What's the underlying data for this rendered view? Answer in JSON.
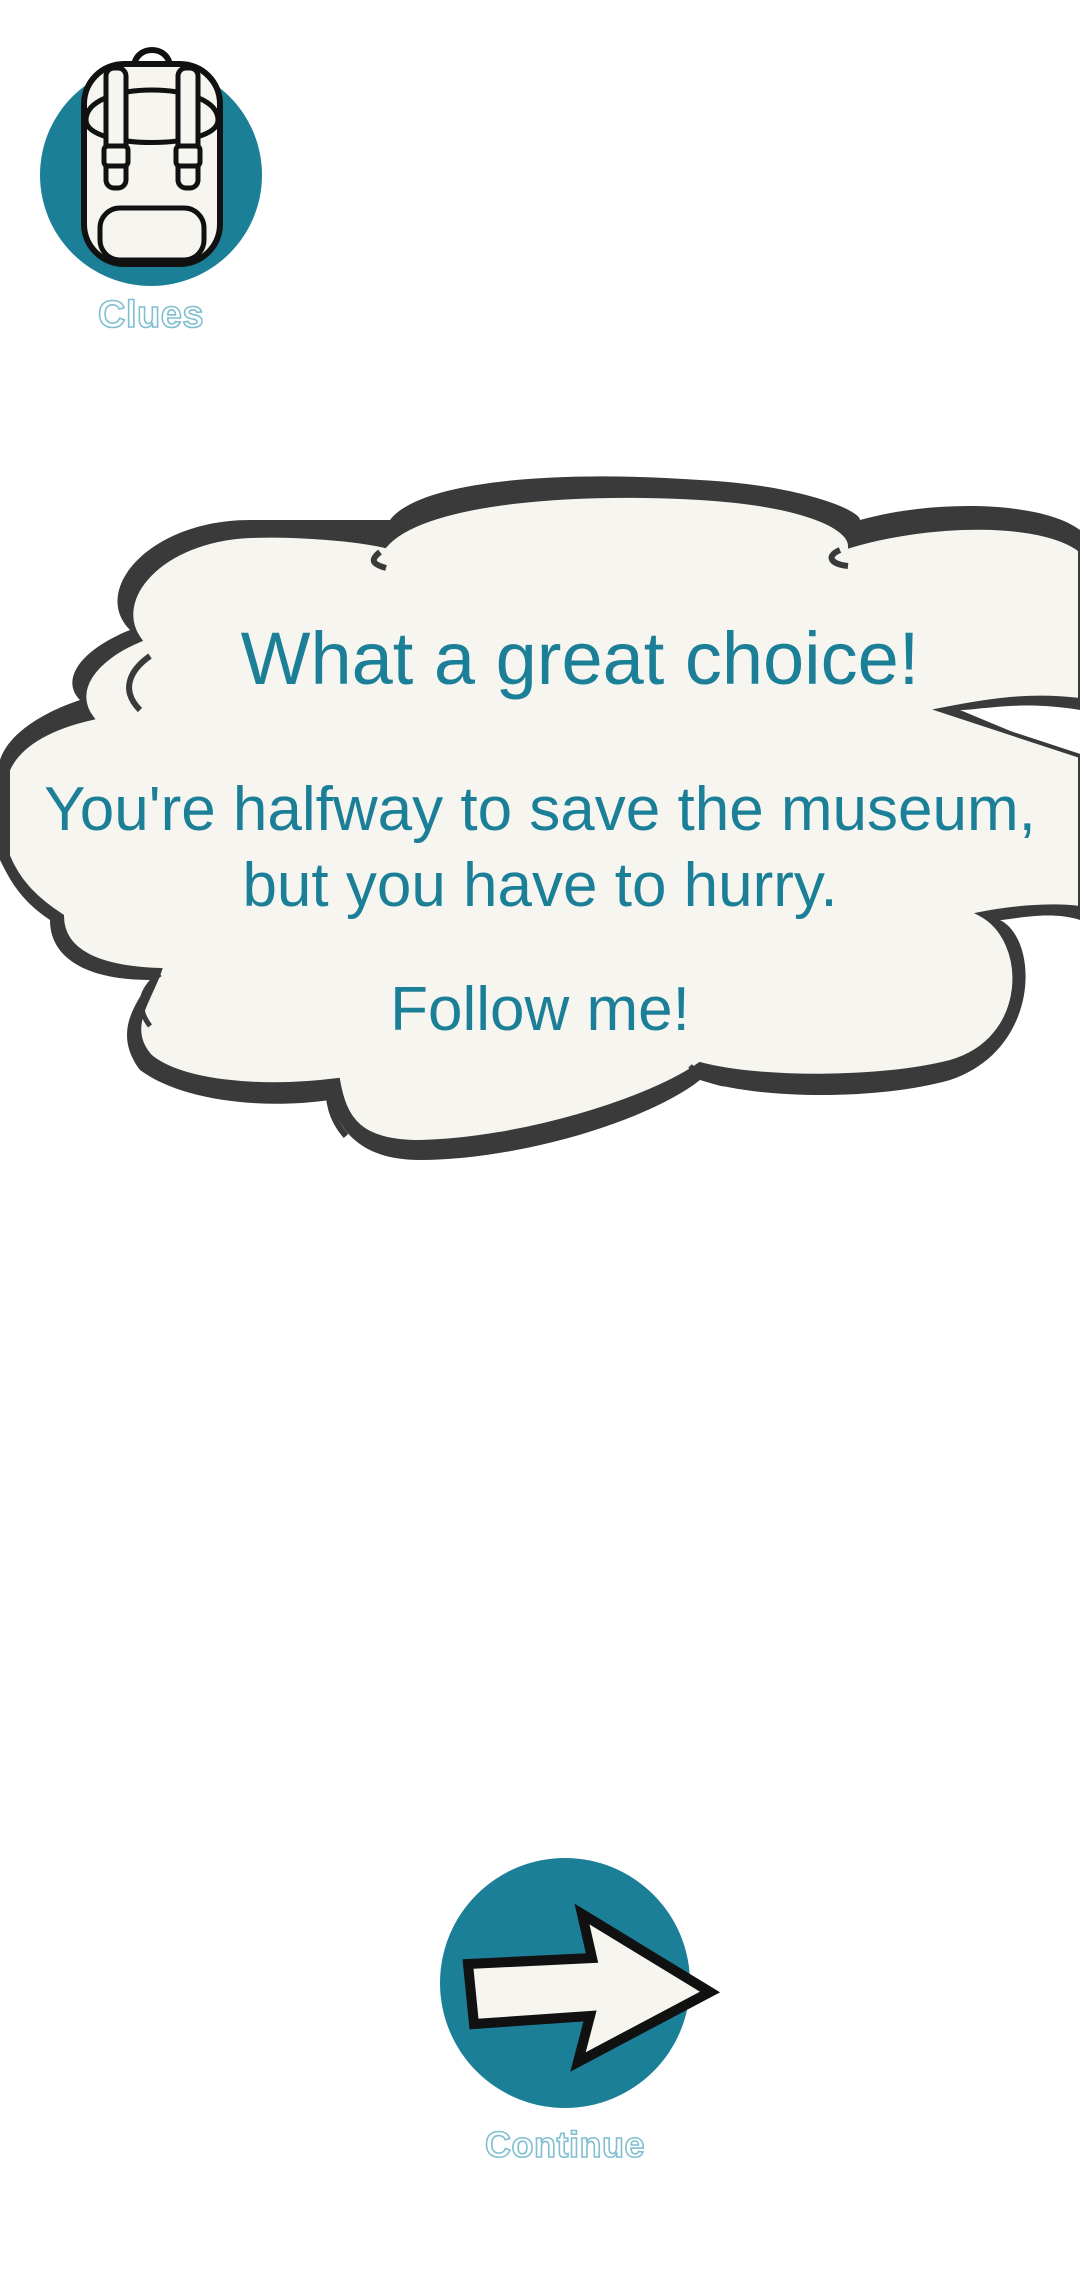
{
  "clues": {
    "label": "Clues",
    "icon": "backpack-icon"
  },
  "bubble": {
    "title": "What a great choice!",
    "line1": "You're halfway to save the museum,",
    "line2": "but you have to hurry.",
    "line3": "Follow me!"
  },
  "continue": {
    "label": "Continue",
    "icon": "arrow-right-icon"
  },
  "colors": {
    "accent": "#1c7f98",
    "bubble_fill": "#f6f5ef",
    "outline": "#3a3a3a",
    "label_outline": "#7fbfd0"
  }
}
